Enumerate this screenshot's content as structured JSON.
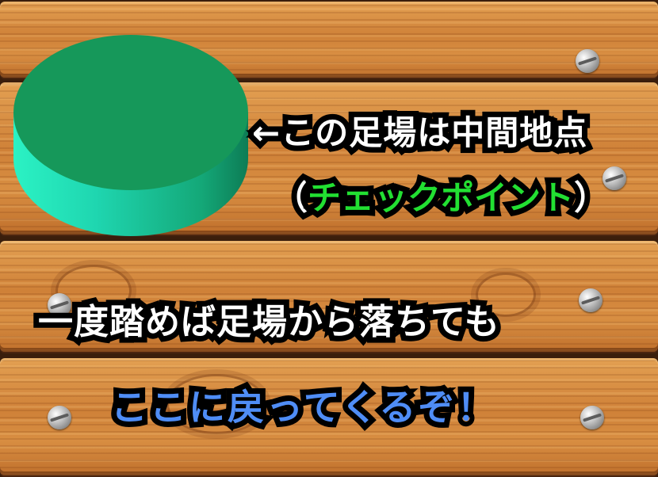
{
  "scene": {
    "colors": {
      "wood": "#cf8138",
      "platform_top": "#16985a",
      "platform_side": "#1fd6b0",
      "highlight_green": "#22e032",
      "highlight_blue": "#4f8df6",
      "outline": "#000000"
    },
    "platform_icon": "green-checkpoint-platform",
    "caption": {
      "line1": "←この足場は中間地点",
      "line2_open": "（",
      "line2_highlight": "チェックポイント",
      "line2_close": "）",
      "line3": "一度踏めば足場から落ちても",
      "line4": "ここに戻ってくるぞ！"
    }
  }
}
